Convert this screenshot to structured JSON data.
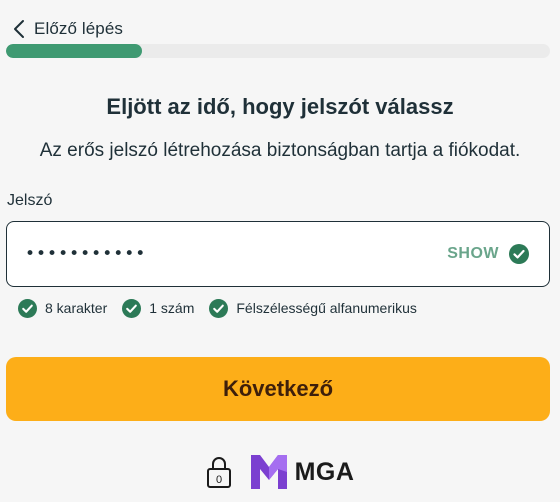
{
  "nav": {
    "back_label": "Előző lépés"
  },
  "progress": {
    "fraction": 0.25,
    "color": "#3f9a72"
  },
  "headline": "Eljött az idő, hogy jelszót válassz",
  "subtitle": "Az erős jelszó létrehozása biztonságban tartja a fiókodat.",
  "password_field": {
    "label": "Jelszó",
    "value": "•••••••••••",
    "show_label": "SHOW",
    "valid": true
  },
  "requirements": [
    {
      "label": "8 karakter",
      "met": true
    },
    {
      "label": "1 szám",
      "met": true
    },
    {
      "label": "Félszélességű alfanumerikus",
      "met": true
    }
  ],
  "next_button": {
    "label": "Következő",
    "color": "#fdae18"
  },
  "footer": {
    "age_badge": "0",
    "license_logo": "MGA"
  },
  "icons": {
    "back": "chevron-left-icon",
    "valid": "check-circle-icon",
    "lock": "lock-icon",
    "mga": "mga-logo"
  }
}
